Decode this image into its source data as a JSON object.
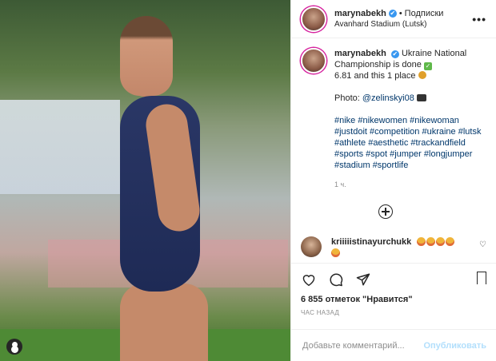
{
  "header": {
    "username": "marynabekh",
    "verified_mark": "✔",
    "separator": "•",
    "follow_label": "Подписки",
    "location": "Avanhard Stadium (Lutsk)",
    "more_label": "•••"
  },
  "caption": {
    "username": "marynabekh",
    "line1": "Ukraine National Championship is done",
    "check_mark": "✓",
    "line2": "6.81 and this 1 place",
    "photo_prefix": "Photo: ",
    "photo_handle": "@zelinskyi08",
    "hashtags": "#nike #nikewomen #nikewoman #justdoit #competition #ukraine #lutsk #athlete #aesthetic #trackandfield #sports #spot #jumper #longjumper #stadium #sportlife",
    "time": "1 ч."
  },
  "comment": {
    "username": "kriiiiistinayurchukk"
  },
  "likes_text": "6 855 отметок \"Нравится\"",
  "time_ago": "ЧАС НАЗАД",
  "add_comment": {
    "placeholder": "Добавьте комментарий...",
    "post_label": "Опубликовать"
  },
  "icons": {
    "like": "heart-icon",
    "comment": "comment-icon",
    "share": "share-icon",
    "save": "bookmark-icon"
  },
  "colors": {
    "link": "#00376b",
    "verified": "#3897f0",
    "post_button": "#b2dffc"
  }
}
